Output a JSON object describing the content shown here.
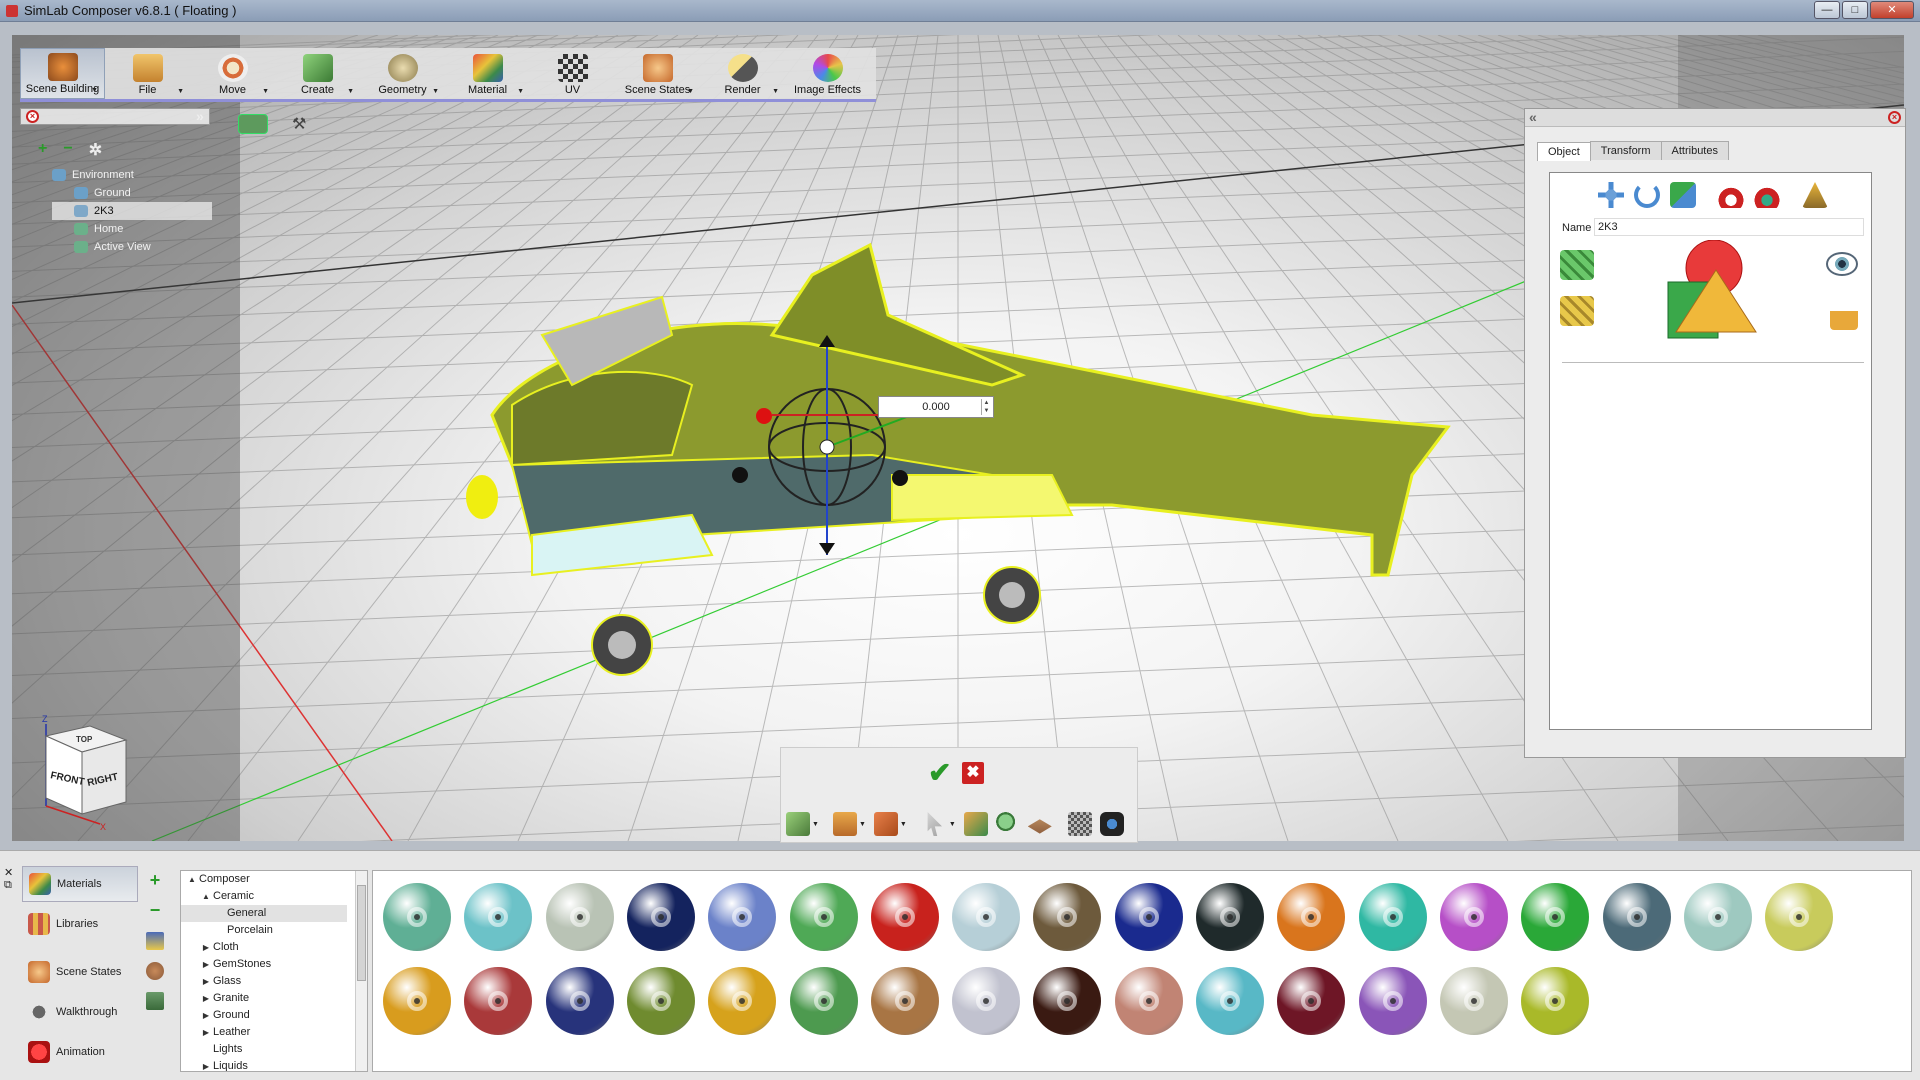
{
  "window": {
    "title": "SimLab Composer v6.8.1 ( Floating )",
    "controls": [
      "—",
      "□",
      "✕"
    ]
  },
  "toolbar": {
    "items": [
      {
        "label": "Scene Building",
        "icon": "scene-building-icon",
        "active": true,
        "color": "#d7802f"
      },
      {
        "label": "File",
        "icon": "file-icon",
        "active": false,
        "color": "#d9a24a"
      },
      {
        "label": "Move",
        "icon": "move-icon",
        "active": false,
        "color": "#d86c3a"
      },
      {
        "label": "Create",
        "icon": "create-cube-icon",
        "active": false,
        "color": "#4f9a44"
      },
      {
        "label": "Geometry",
        "icon": "geometry-icon",
        "active": false,
        "color": "#b59a5a"
      },
      {
        "label": "Material",
        "icon": "material-icon",
        "active": false,
        "color": "#c9583d"
      },
      {
        "label": "UV",
        "icon": "uv-checker-icon",
        "active": false,
        "color": "#555555"
      },
      {
        "label": "Scene States",
        "icon": "scene-states-icon",
        "active": false,
        "color": "#d9894b"
      },
      {
        "label": "Render",
        "icon": "render-icon",
        "active": false,
        "color": "#c9a640"
      },
      {
        "label": "Image Effects",
        "icon": "image-effects-icon",
        "active": false,
        "color": "#7a8fd0"
      }
    ]
  },
  "scene_tree": {
    "search_placeholder": "",
    "items": [
      {
        "label": "Environment",
        "icon": "environment-icon",
        "level": 0,
        "selected": false
      },
      {
        "label": "Ground",
        "icon": "ground-icon",
        "level": 1,
        "selected": false
      },
      {
        "label": "2K3",
        "icon": "object-icon",
        "level": 1,
        "selected": true
      },
      {
        "label": "Home",
        "icon": "camera-icon",
        "level": 1,
        "selected": false
      },
      {
        "label": "Active View",
        "icon": "camera-icon",
        "level": 1,
        "selected": false
      }
    ]
  },
  "gizmo": {
    "value": "0.000"
  },
  "navcube": {
    "faces": [
      "TOP",
      "FRONT",
      "RIGHT"
    ],
    "axis_z": "Z",
    "axis_x": "X"
  },
  "properties": {
    "tabs": [
      "Object",
      "Transform",
      "Attributes"
    ],
    "active_tab": "Object",
    "name_label": "Name",
    "name_value": "2K3"
  },
  "bottom_sidebar": {
    "items": [
      {
        "label": "Materials",
        "icon": "materials-icon",
        "active": true
      },
      {
        "label": "Libraries",
        "icon": "libraries-icon",
        "active": false
      },
      {
        "label": "Scene States",
        "icon": "scene-states-icon",
        "active": false
      },
      {
        "label": "Walkthrough",
        "icon": "walkthrough-icon",
        "active": false
      },
      {
        "label": "Animation",
        "icon": "animation-icon",
        "active": false
      }
    ]
  },
  "library_tree": [
    {
      "label": "Composer",
      "level": 0,
      "arrow": "▲"
    },
    {
      "label": "Ceramic",
      "level": 1,
      "arrow": "▲"
    },
    {
      "label": "General",
      "level": 2,
      "arrow": "",
      "selected": true
    },
    {
      "label": "Porcelain",
      "level": 2,
      "arrow": ""
    },
    {
      "label": "Cloth",
      "level": 1,
      "arrow": "▶"
    },
    {
      "label": "GemStones",
      "level": 1,
      "arrow": "▶"
    },
    {
      "label": "Glass",
      "level": 1,
      "arrow": "▶"
    },
    {
      "label": "Granite",
      "level": 1,
      "arrow": "▶"
    },
    {
      "label": "Ground",
      "level": 1,
      "arrow": "▶"
    },
    {
      "label": "Leather",
      "level": 1,
      "arrow": "▶"
    },
    {
      "label": "Lights",
      "level": 1,
      "arrow": ""
    },
    {
      "label": "Liquids",
      "level": 1,
      "arrow": "▶"
    }
  ],
  "swatches": {
    "row1": [
      "#5faf95",
      "#6cc2c8",
      "#b9c3b5",
      "#14235e",
      "#6b82c9",
      "#4fa956",
      "#c8221d",
      "#b6cfd7",
      "#6d5a3c",
      "#1a2a8e",
      "#1f2a2b",
      "#d9751d",
      "#2fb8a3",
      "#b64fc7",
      "#2aa838",
      "#4c6a78",
      "#9ec9c0",
      "#c8cb5c"
    ],
    "row2": [
      "#d89c1e",
      "#a9393a",
      "#27337b",
      "#6f8b2f",
      "#d6a21c",
      "#4d9a4f",
      "#a87544",
      "#c1c2cf",
      "#3a1a12",
      "#c18474",
      "#58b8c6",
      "#6e1626",
      "#8a55b8",
      "#c4c7b4",
      "#a9b929"
    ]
  }
}
